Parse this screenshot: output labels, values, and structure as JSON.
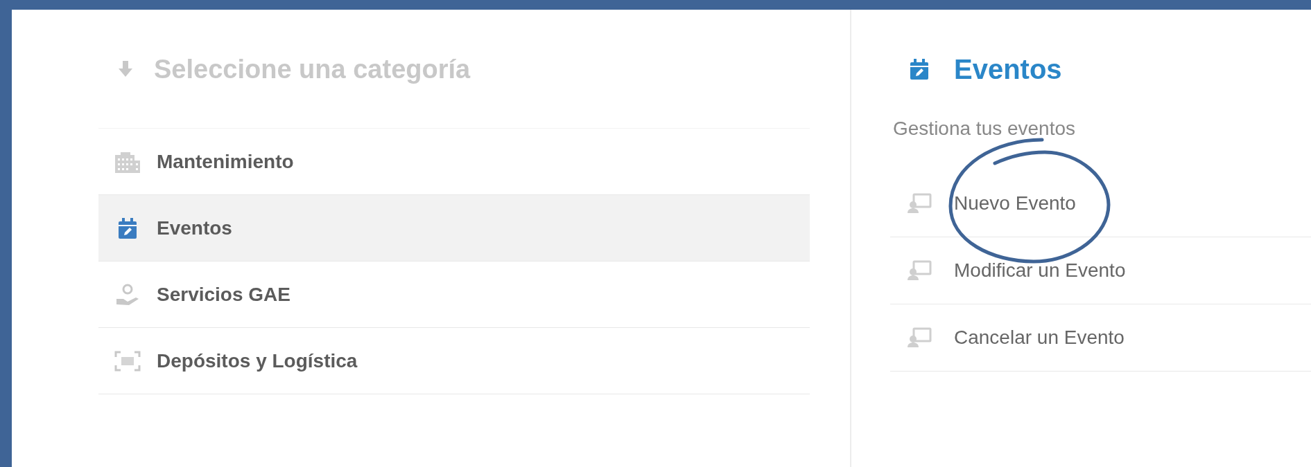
{
  "categories": {
    "title": "Seleccione una categoría",
    "items": [
      {
        "label": "Mantenimiento",
        "selected": false
      },
      {
        "label": "Eventos",
        "selected": true
      },
      {
        "label": "Servicios GAE",
        "selected": false
      },
      {
        "label": "Depósitos y Logística",
        "selected": false
      }
    ]
  },
  "section": {
    "title": "Eventos",
    "subtitle": "Gestiona tus eventos",
    "actions": [
      {
        "label": "Nuevo Evento",
        "circled": true
      },
      {
        "label": "Modificar un Evento",
        "circled": false
      },
      {
        "label": "Cancelar un Evento",
        "circled": false
      }
    ]
  }
}
